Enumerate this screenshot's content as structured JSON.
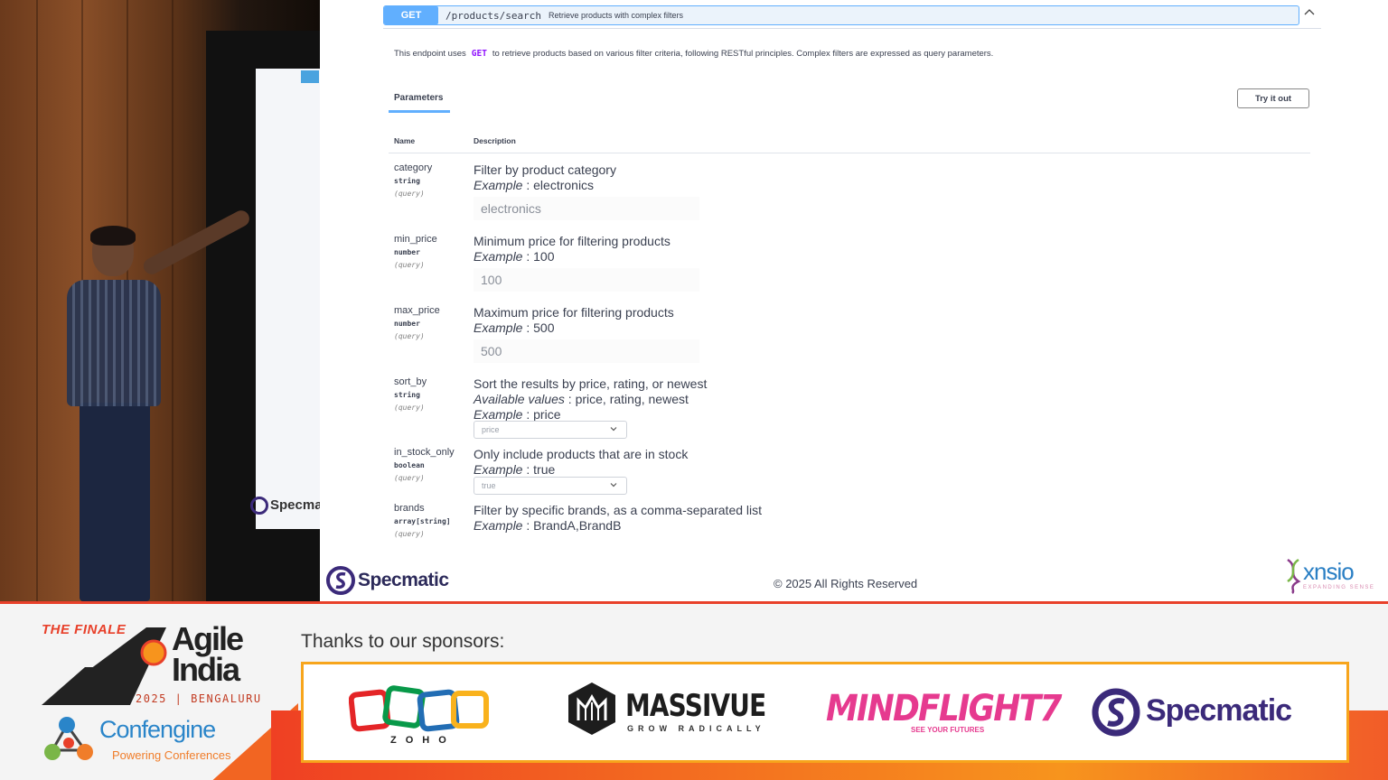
{
  "swagger": {
    "operation": {
      "method": "GET",
      "path": "/products/search",
      "summary": "Retrieve products with complex filters"
    },
    "description": {
      "before": "This endpoint uses",
      "code": "GET",
      "after": "to retrieve products based on various filter criteria, following RESTful principles. Complex filters are expressed as query parameters."
    },
    "parameters_tab": "Parameters",
    "try_it_out": "Try it out",
    "table_headers": {
      "name": "Name",
      "description": "Description"
    },
    "params": [
      {
        "name": "category",
        "type": "string",
        "in": "(query)",
        "desc": "Filter by product category",
        "example_label": "Example",
        "example": " : electronics",
        "value": "electronics",
        "control": "input"
      },
      {
        "name": "min_price",
        "type": "number",
        "in": "(query)",
        "desc": "Minimum price for filtering products",
        "example_label": "Example",
        "example": " : 100",
        "value": "100",
        "control": "input"
      },
      {
        "name": "max_price",
        "type": "number",
        "in": "(query)",
        "desc": "Maximum price for filtering products",
        "example_label": "Example",
        "example": " : 500",
        "value": "500",
        "control": "input"
      },
      {
        "name": "sort_by",
        "type": "string",
        "in": "(query)",
        "desc": "Sort the results by price, rating, or newest",
        "available_label": "Available values",
        "available": " : price, rating, newest",
        "example_label": "Example",
        "example": " : price",
        "value": "price",
        "control": "select"
      },
      {
        "name": "in_stock_only",
        "type": "boolean",
        "in": "(query)",
        "desc": "Only include products that are in stock",
        "example_label": "Example",
        "example": " : true",
        "value": "true",
        "control": "select"
      },
      {
        "name": "brands",
        "type": "array[string]",
        "in": "(query)",
        "desc": "Filter by specific brands, as a comma-separated list",
        "example_label": "Example",
        "example": " : BrandA,BrandB",
        "control": "none"
      }
    ],
    "footer": {
      "brand": "Specmatic",
      "copyright": "© 2025 All Rights Reserved",
      "xnsio": "xnsio",
      "xnsio_tag": "EXPANDING SENSE"
    }
  },
  "stage": {
    "screen_brand": "Specma"
  },
  "banner": {
    "finale": "THE FINALE",
    "agile_line1": "Agile",
    "agile_line2": "India",
    "year_city": "2025 | BENGALURU",
    "confengine": "Confengine",
    "confengine_tag": "Powering Conferences",
    "thanks": "Thanks to our sponsors:",
    "sponsors": {
      "zoho": "ZOHO",
      "massivue": "MASSIVUE",
      "massivue_tag": "GROW RADICALLY",
      "mindflight": "MINDFLIGHT7",
      "mindflight_tag": "SEE YOUR FUTURES",
      "specmatic": "Specmatic"
    }
  },
  "colors": {
    "get_blue": "#61affe",
    "get_code_purple": "#9012fe",
    "banner_orange": "#f26522",
    "sponsor_border": "#f7a51c",
    "specmatic_purple": "#3b2a7a",
    "mindflight_pink": "#e63a8f"
  }
}
